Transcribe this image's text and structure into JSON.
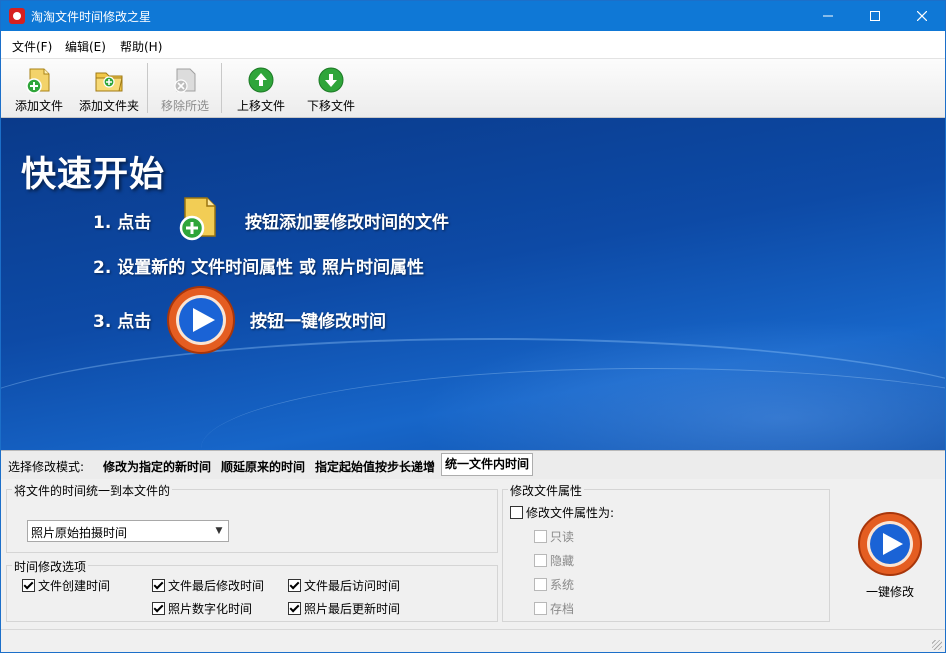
{
  "window": {
    "title": "淘淘文件时间修改之星"
  },
  "menu": {
    "items": [
      "文件(F)",
      "编辑(E)",
      "帮助(H)"
    ]
  },
  "toolbar": {
    "add_file": "添加文件",
    "add_folder": "添加文件夹",
    "remove_selected": "移除所选",
    "move_up": "上移文件",
    "move_down": "下移文件"
  },
  "hero": {
    "title": "快速开始",
    "step1_prefix": "1.  点击",
    "step1_suffix": "按钮添加要修改时间的文件",
    "step2": "2.  设置新的 文件时间属性 或 照片时间属性",
    "step3_prefix": "3.  点击",
    "step3_suffix": "按钮一键修改时间"
  },
  "mode": {
    "label": "选择修改模式:",
    "tabs": [
      "修改为指定的新时间",
      "顺延原来的时间",
      "指定起始值按步长递增",
      "统一文件内时间"
    ],
    "active": "统一文件内时间"
  },
  "unify": {
    "group_title": "将文件的时间统一到本文件的",
    "select_value": "照片原始拍摄时间"
  },
  "time_options": {
    "group_title": "时间修改选项",
    "file_created": "文件创建时间",
    "file_modified": "文件最后修改时间",
    "file_accessed": "文件最后访问时间",
    "photo_digitized": "照片数字化时间",
    "photo_updated": "照片最后更新时间"
  },
  "attributes": {
    "group_title": "修改文件属性",
    "modify_label": "修改文件属性为:",
    "readonly": "只读",
    "hidden": "隐藏",
    "system": "系统",
    "archive": "存档"
  },
  "action": {
    "one_click": "一键修改"
  },
  "colors": {
    "titlebar": "#0f78d6",
    "hero": "#0d4aa6",
    "orange": "#ec6a2a",
    "green": "#2fa53a"
  }
}
